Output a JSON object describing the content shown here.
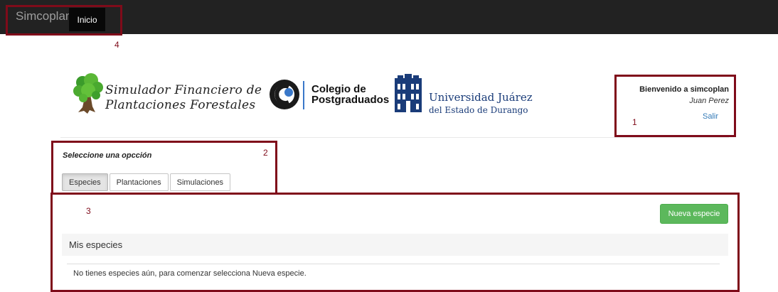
{
  "navbar": {
    "brand": "Simcoplan",
    "active_item": "Inicio"
  },
  "callouts": {
    "one": "1",
    "two": "2",
    "three": "3",
    "four": "4"
  },
  "header": {
    "app_title_line1": "Simulador Financiero de",
    "app_title_line2": "Plantaciones Forestales",
    "cp_line1": "Colegio de",
    "cp_line2": "Postgraduados",
    "ujed_line1": "Universidad Juárez",
    "ujed_line2": "del Estado de Durango"
  },
  "user_panel": {
    "welcome": "Bienvenido a simcoplan",
    "user_name": "Juan Perez",
    "logout": "Salir"
  },
  "options": {
    "label": "Seleccione una opcción",
    "tabs": [
      "Especies",
      "Plantaciones",
      "Simulaciones"
    ],
    "active_tab": "Especies"
  },
  "species": {
    "new_button": "Nueva especie",
    "panel_title": "Mis especies",
    "empty_message": "No tienes especies aún, para comenzar selecciona Nueva especie."
  },
  "colors": {
    "navbar_bg": "#222222",
    "annotation": "#7f0b1a",
    "success": "#5cb85c",
    "link": "#337ab7",
    "ujed_blue": "#1a3c79"
  }
}
